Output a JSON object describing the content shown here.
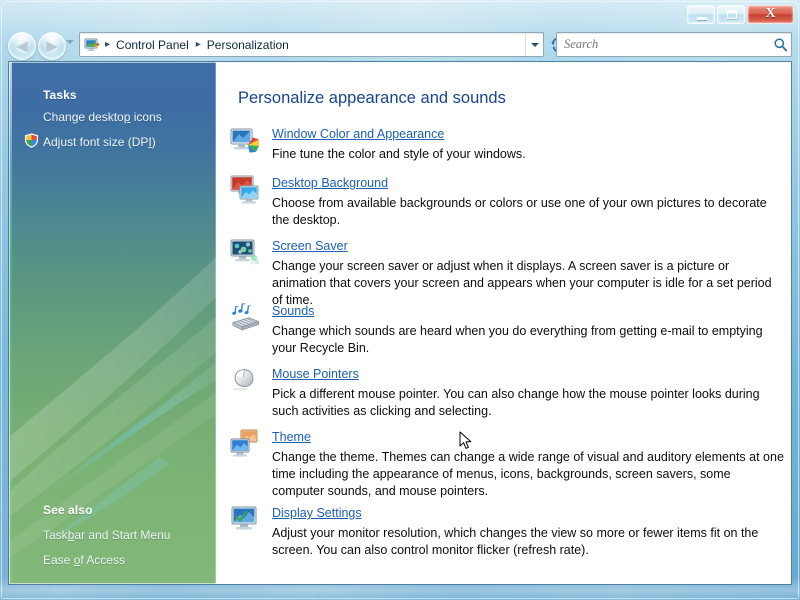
{
  "window": {
    "caption_buttons": {
      "minimize_label": "Minimize",
      "maximize_label": "Maximize",
      "close_label": "X"
    }
  },
  "navigation": {
    "back_label": "◀",
    "forward_label": "▶",
    "history_label": "Recent pages",
    "refresh_label": "Refresh",
    "address_icon_name": "personalization-icon",
    "breadcrumbs": [
      {
        "label": "Control Panel"
      },
      {
        "label": "Personalization"
      }
    ],
    "separator": "▶",
    "dropdown_label": "Previous locations"
  },
  "search": {
    "placeholder": "Search",
    "value": "",
    "icon_name": "magnifier-icon"
  },
  "sidebar": {
    "tasks_heading": "Tasks",
    "tasks": [
      {
        "label": "Change desktop icons",
        "icon": "",
        "underline_char": "p"
      },
      {
        "label": "Adjust font size (DPI)",
        "icon": "uac-shield-icon",
        "underline_char": "I"
      }
    ],
    "see_also_heading": "See also",
    "see_also": [
      {
        "label": "Taskbar and Start Menu",
        "underline_char": "b"
      },
      {
        "label": "Ease of Access",
        "underline_char": "o"
      }
    ]
  },
  "main": {
    "title": "Personalize appearance and sounds",
    "items": [
      {
        "icon": "window-color-icon",
        "link": "Window Color and Appearance",
        "description": "Fine tune the color and style of your windows."
      },
      {
        "icon": "desktop-background-icon",
        "link": "Desktop Background",
        "description": "Choose from available backgrounds or colors or use one of your own pictures to decorate the desktop."
      },
      {
        "icon": "screen-saver-icon",
        "link": "Screen Saver",
        "description": "Change your screen saver or adjust when it displays. A screen saver is a picture or animation that covers your screen and appears when your computer is idle for a set period of time."
      },
      {
        "icon": "sounds-icon",
        "link": "Sounds",
        "description": "Change which sounds are heard when you do everything from getting e-mail to emptying your Recycle Bin."
      },
      {
        "icon": "mouse-pointers-icon",
        "link": "Mouse Pointers",
        "description": "Pick a different mouse pointer. You can also change how the mouse pointer looks during such activities as clicking and selecting."
      },
      {
        "icon": "theme-icon",
        "link": "Theme",
        "description": "Change the theme. Themes can change a wide range of visual and auditory elements at one time including the appearance of menus, icons, backgrounds, screen savers, some computer sounds, and mouse pointers."
      },
      {
        "icon": "display-settings-icon",
        "link": "Display Settings",
        "description": "Adjust your monitor resolution, which changes the view so more or fewer items fit on the screen. You can also control monitor flicker (refresh rate)."
      }
    ]
  },
  "colors": {
    "link": "#1c5fb3",
    "title": "#17468a",
    "frame_blue": "#7fbcdc",
    "close_red": "#c33f2d",
    "sidebar_top": "#3e6ea6",
    "sidebar_bottom": "#82b878"
  }
}
